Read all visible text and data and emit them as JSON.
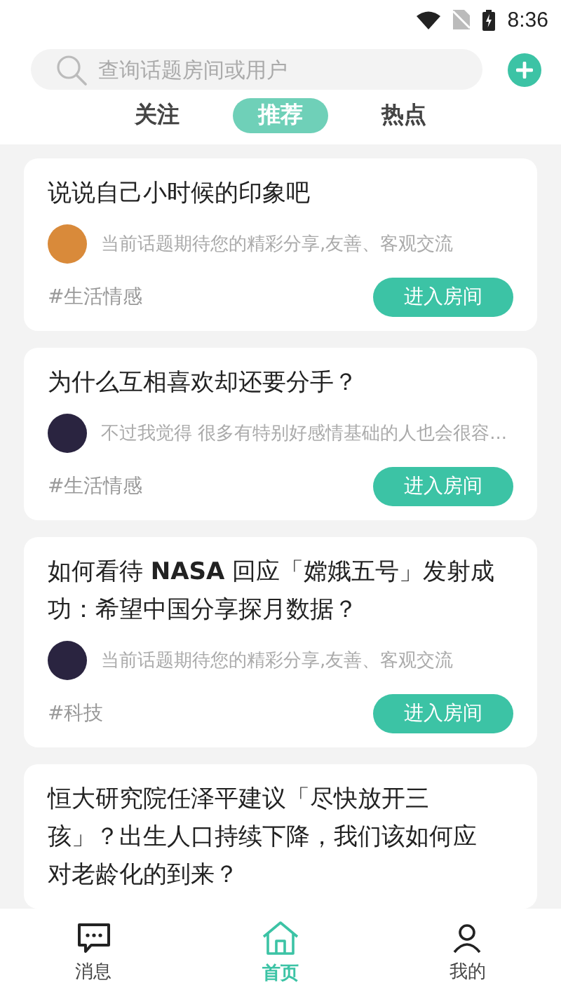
{
  "status_bar": {
    "time": "8:36"
  },
  "search": {
    "placeholder": "查询话题房间或用户"
  },
  "tabs": [
    {
      "label": "关注",
      "selected": false
    },
    {
      "label": "推荐",
      "selected": true
    },
    {
      "label": "热点",
      "selected": false
    }
  ],
  "topics": [
    {
      "title": "说说自己小时候的印象吧",
      "color": "#d98a3a",
      "snippet": "当前话题期待您的精彩分享,友善、客观交流",
      "tag": "#生活情感",
      "button": "进入房间"
    },
    {
      "title": "为什么互相喜欢却还要分手？",
      "color": "#2a2440",
      "snippet": "不过我觉得 很多有特别好感情基础的人也会很容...",
      "tag": "#生活情感",
      "button": "进入房间"
    },
    {
      "title": "如何看待 **NASA** 回应「嫦娥五号」发射成功：希望中国分享探月数据？",
      "color": "#2a2440",
      "snippet": "当前话题期待您的精彩分享,友善、客观交流",
      "tag": "#科技",
      "button": "进入房间"
    },
    {
      "title": "恒大研究院任泽平建议「尽快放开三孩」？出生人口持续下降，我们该如何应对老龄化的到来？"
    }
  ],
  "nav": [
    {
      "label": "消息",
      "kind": "chat",
      "selected": false
    },
    {
      "label": "首页",
      "kind": "home",
      "selected": true
    },
    {
      "label": "我的",
      "kind": "person",
      "selected": false
    }
  ]
}
